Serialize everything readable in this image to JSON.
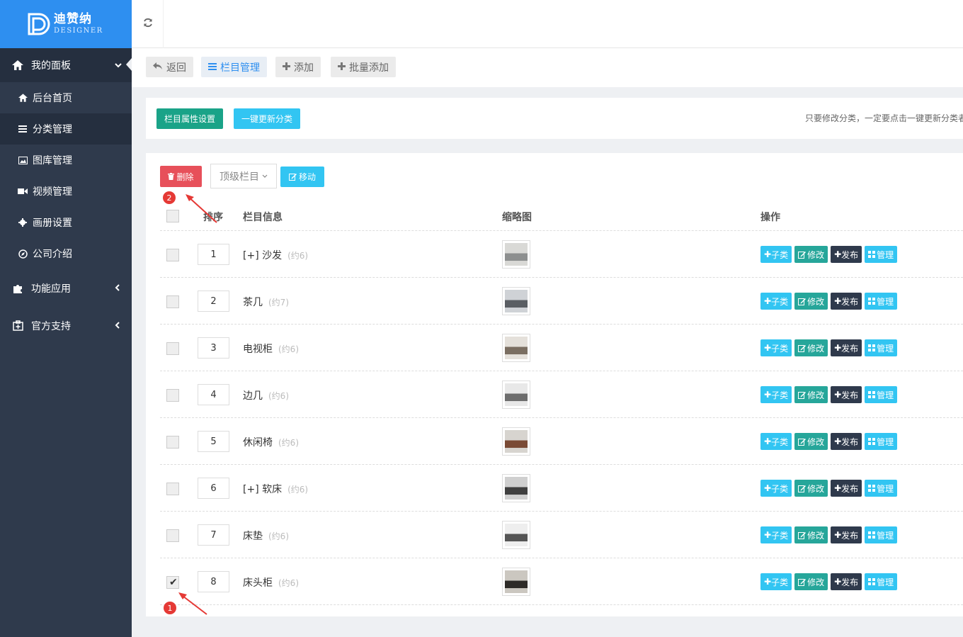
{
  "brand": {
    "name_cn": "迪赞纳",
    "name_en": "DESIGNER",
    "color": "#2e8ff0"
  },
  "sidebar": {
    "main_menu": {
      "label": "我的面板",
      "icon": "home-icon"
    },
    "sub_items": [
      {
        "label": "后台首页",
        "icon": "home-icon",
        "active": false
      },
      {
        "label": "分类管理",
        "icon": "list-icon",
        "active": true
      },
      {
        "label": "图库管理",
        "icon": "image-icon",
        "active": false
      },
      {
        "label": "视频管理",
        "icon": "video-icon",
        "active": false
      },
      {
        "label": "画册设置",
        "icon": "gear-icon",
        "active": false
      },
      {
        "label": "公司介绍",
        "icon": "compass-icon",
        "active": false
      }
    ],
    "groups": [
      {
        "label": "功能应用",
        "icon": "puzzle-icon"
      },
      {
        "label": "官方支持",
        "icon": "support-icon"
      }
    ]
  },
  "toolbar": {
    "back": "返回",
    "category_manage": "栏目管理",
    "add": "添加",
    "batch_add": "批量添加"
  },
  "panel": {
    "attr_settings": "栏目属性设置",
    "update_all": "一键更新分类",
    "hint": "只要修改分类，一定要点击一键更新分类者"
  },
  "list": {
    "delete": "删除",
    "parent_select": "顶级栏目",
    "move": "移动",
    "headers": {
      "order": "排序",
      "info": "栏目信息",
      "thumb": "缩略图",
      "ops": "操作"
    },
    "op_labels": {
      "child": "子类",
      "edit": "修改",
      "publish": "发布",
      "manage": "管理"
    },
    "rows": [
      {
        "order": "1",
        "name": "[+] 沙发",
        "count": "(约6)",
        "checked": false
      },
      {
        "order": "2",
        "name": "茶几",
        "count": "(约7)",
        "checked": false
      },
      {
        "order": "3",
        "name": "电视柜",
        "count": "(约6)",
        "checked": false
      },
      {
        "order": "4",
        "name": "边几",
        "count": "(约6)",
        "checked": false
      },
      {
        "order": "5",
        "name": "休闲椅",
        "count": "(约6)",
        "checked": false
      },
      {
        "order": "6",
        "name": "[+] 软床",
        "count": "(约6)",
        "checked": false
      },
      {
        "order": "7",
        "name": "床垫",
        "count": "(约6)",
        "checked": false
      },
      {
        "order": "8",
        "name": "床头柜",
        "count": "(约6)",
        "checked": true
      }
    ]
  },
  "annotations": {
    "step1": "1",
    "step2": "2"
  }
}
